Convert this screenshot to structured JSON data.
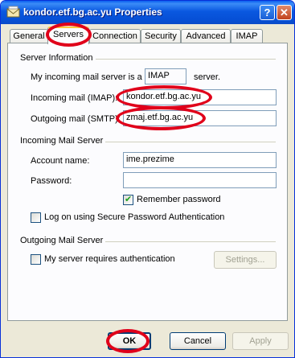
{
  "window": {
    "title": "kondor.etf.bg.ac.yu Properties",
    "help_label": "?",
    "close_label": "✕"
  },
  "tabs": [
    {
      "label": "General"
    },
    {
      "label": "Servers",
      "active": true
    },
    {
      "label": "Connection"
    },
    {
      "label": "Security"
    },
    {
      "label": "Advanced"
    },
    {
      "label": "IMAP"
    }
  ],
  "server_info": {
    "heading": "Server Information",
    "type_prefix": "My incoming mail server is a",
    "type_value": "IMAP",
    "type_suffix": "server.",
    "incoming_label": "Incoming mail (IMAP):",
    "incoming_value": "kondor.etf.bg.ac.yu",
    "outgoing_label": "Outgoing mail (SMTP):",
    "outgoing_value": "zmaj.etf.bg.ac.yu"
  },
  "incoming_server": {
    "heading": "Incoming Mail Server",
    "account_label": "Account name:",
    "account_value": "ime.prezime",
    "password_label": "Password:",
    "password_value": "",
    "remember_label": "Remember password",
    "remember_checked": true,
    "spa_label": "Log on using Secure Password Authentication",
    "spa_checked": false
  },
  "outgoing_server": {
    "heading": "Outgoing Mail Server",
    "auth_label": "My server requires authentication",
    "auth_checked": false,
    "settings_label": "Settings..."
  },
  "buttons": {
    "ok": "OK",
    "cancel": "Cancel",
    "apply": "Apply"
  },
  "colors": {
    "highlight_ellipse": "#e0001a",
    "title_bar": "#0a58e0",
    "dialog_background": "#ece9d8"
  }
}
